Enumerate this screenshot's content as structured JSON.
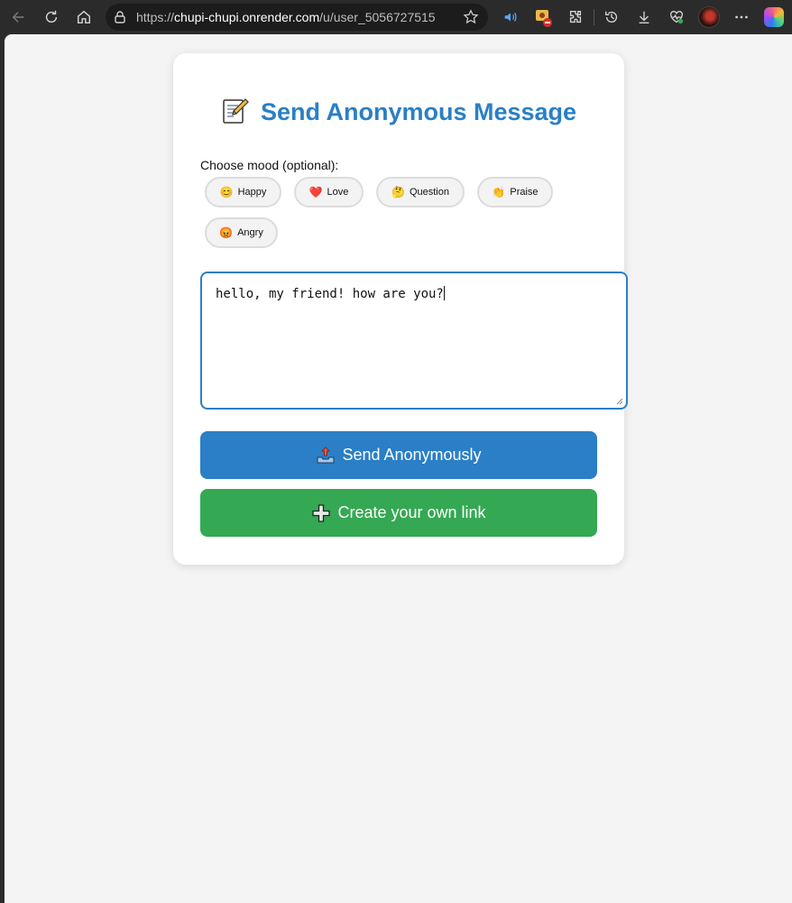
{
  "browser": {
    "url_prefix": "https://",
    "url_host": "chupi-chupi.onrender.com",
    "url_path": "/u/user_5056727515"
  },
  "card": {
    "title": "Send Anonymous Message",
    "mood_label": "Choose mood (optional):",
    "moods": [
      {
        "emoji": "😊",
        "label": "Happy"
      },
      {
        "emoji": "❤️",
        "label": "Love"
      },
      {
        "emoji": "🤔",
        "label": "Question"
      },
      {
        "emoji": "👏",
        "label": "Praise"
      },
      {
        "emoji": "😡",
        "label": "Angry"
      }
    ],
    "message_value": "hello, my friend! how are you?",
    "send_label": "Send Anonymously",
    "create_label": "Create your own link"
  },
  "colors": {
    "accent": "#2a7fc6",
    "create": "#34a853",
    "page_bg": "#f4f4f4"
  },
  "icons": [
    "back-icon",
    "refresh-icon",
    "home-icon",
    "lock-icon",
    "star-icon",
    "read-aloud-icon",
    "extension-badge-icon",
    "extensions-icon",
    "history-icon",
    "download-icon",
    "performance-icon",
    "profile-avatar",
    "more-icon",
    "copilot-icon",
    "memo-icon",
    "outbox-tray-icon",
    "plus-icon"
  ]
}
